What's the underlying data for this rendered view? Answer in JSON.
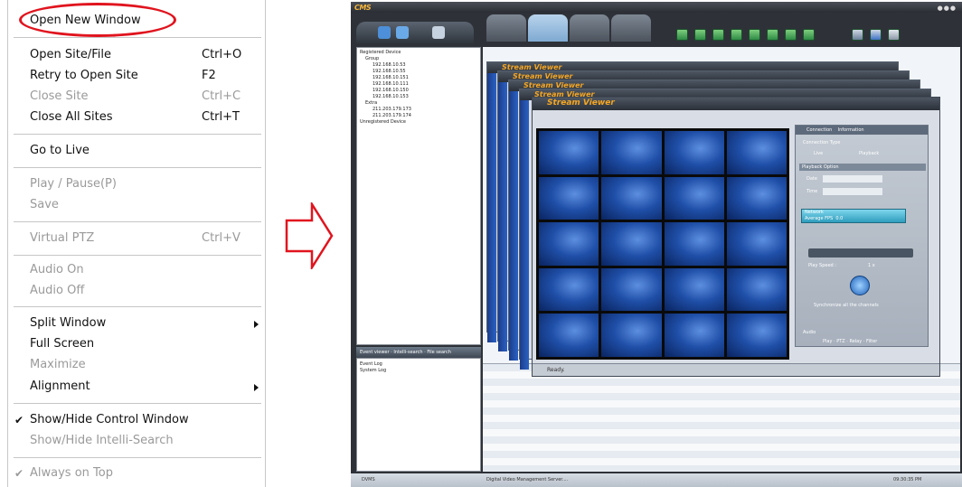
{
  "context_menu": {
    "items": [
      {
        "label": "Open New Window",
        "shortcut": "",
        "enabled": true
      },
      {
        "label": "Open Site/File",
        "shortcut": "Ctrl+O",
        "enabled": true
      },
      {
        "label": "Retry to Open Site",
        "shortcut": "F2",
        "enabled": true
      },
      {
        "label": "Close Site",
        "shortcut": "Ctrl+C",
        "enabled": false
      },
      {
        "label": "Close All Sites",
        "shortcut": "Ctrl+T",
        "enabled": true
      },
      {
        "label": "Go to Live",
        "shortcut": "",
        "enabled": true
      },
      {
        "label": "Play / Pause(P)",
        "shortcut": "",
        "enabled": false
      },
      {
        "label": "Save",
        "shortcut": "",
        "enabled": false
      },
      {
        "label": "Virtual PTZ",
        "shortcut": "Ctrl+V",
        "enabled": false
      },
      {
        "label": "Audio On",
        "shortcut": "",
        "enabled": false
      },
      {
        "label": "Audio Off",
        "shortcut": "",
        "enabled": false
      },
      {
        "label": "Split Window",
        "shortcut": "",
        "enabled": true,
        "submenu": true
      },
      {
        "label": "Full Screen",
        "shortcut": "",
        "enabled": true
      },
      {
        "label": "Maximize",
        "shortcut": "",
        "enabled": false
      },
      {
        "label": "Alignment",
        "shortcut": "",
        "enabled": true,
        "submenu": true
      },
      {
        "label": "Show/Hide Control Window",
        "shortcut": "",
        "enabled": true,
        "checked": true
      },
      {
        "label": "Show/Hide Intelli-Search",
        "shortcut": "",
        "enabled": false
      },
      {
        "label": "Always on Top",
        "shortcut": "",
        "enabled": false,
        "checked": true
      }
    ],
    "highlight_color": "#e0141e"
  },
  "app": {
    "logo": "CMS",
    "window_controls": "●●●",
    "tree": {
      "items": [
        "Registered Device",
        "Group",
        "192.168.10.53",
        "192.168.10.55",
        "192.168.10.151",
        "192.168.10.111",
        "192.168.10.150",
        "192.168.10.153",
        "Extra",
        "211.203.179.173",
        "211.203.179.174",
        "Unregistered Device"
      ]
    },
    "bottom_tabs": "Event viewer · Intelli-search · File search",
    "log_items": [
      "Event Log",
      "System Log"
    ],
    "stream_viewer_title": "Stream Viewer",
    "control_panel": {
      "tab_connection": "Connection",
      "tab_information": "Information",
      "connection_type": "Connection Type",
      "live": "Live",
      "playback": "Playback",
      "playback_option": "Playback Option",
      "date": "Date",
      "time": "Time",
      "network": "Network",
      "average_fps": "Average FPS",
      "average_fps_value": "0.0",
      "play_speed": "Play Speed :",
      "speed_value": "1 x",
      "synchronize": "Synchronize all the channels",
      "audio": "Audio",
      "bottom_tabs": "Play · PTZ · Relay · Filter"
    },
    "status_text": "Ready.",
    "app_status": {
      "left": "DVMS",
      "middle": "Digital Video Management Server....",
      "right": "09:30:35 PM"
    },
    "accent_color": "#f5a623"
  }
}
